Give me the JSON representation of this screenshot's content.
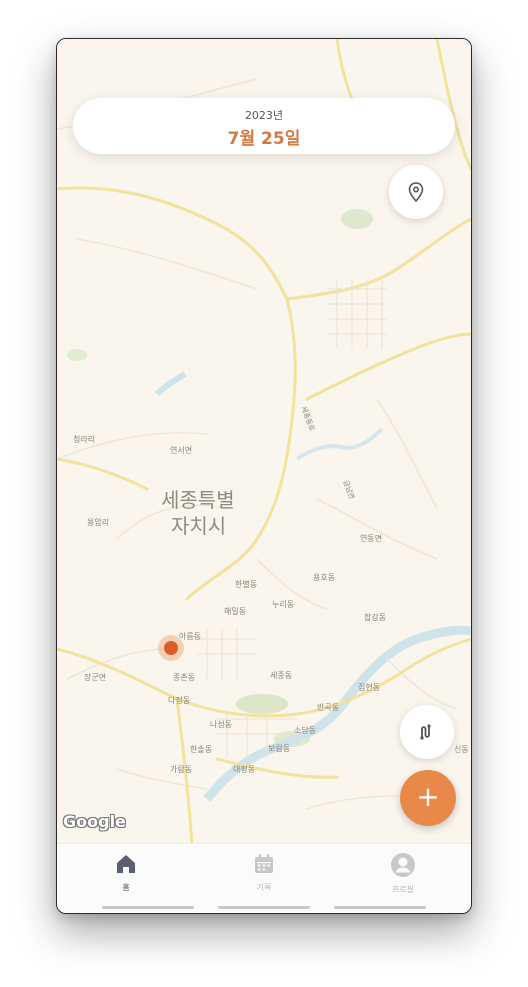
{
  "header": {
    "year": "2023년",
    "date": "7월 25일"
  },
  "map": {
    "city": "세종특별 자치시",
    "labels": [
      "청라리",
      "연서면",
      "용암리",
      "세종특별",
      "자치시",
      "연동면",
      "용호동",
      "한별동",
      "해밀동",
      "누리동",
      "합강동",
      "아름동",
      "장군면",
      "종촌동",
      "세종동",
      "집현동",
      "다정동",
      "반곡동",
      "나성동",
      "소담동",
      "한솔동",
      "보람동",
      "가람동",
      "대평동",
      "신동",
      "세종동로",
      "금남면"
    ],
    "attribution": "Google"
  },
  "buttons": {
    "add_label": "+"
  },
  "tabs": [
    {
      "label": "홈",
      "icon": "home-icon",
      "active": true
    },
    {
      "label": "기록",
      "icon": "calendar-icon",
      "active": false
    },
    {
      "label": "프로필",
      "icon": "profile-icon",
      "active": false
    }
  ],
  "colors": {
    "accent": "#e8894a",
    "marker": "#e05a28",
    "map_bg": "#faf6ee",
    "road": "#f5e6a0"
  }
}
